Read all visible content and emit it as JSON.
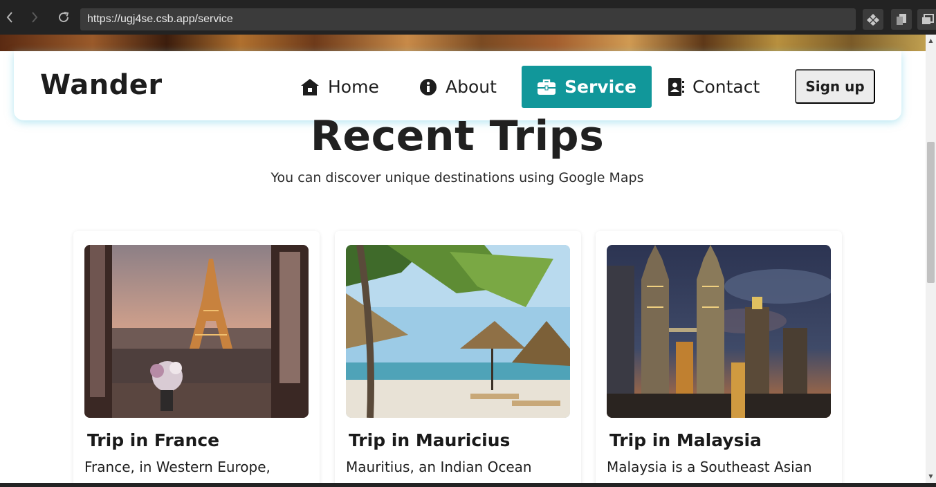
{
  "browser": {
    "url": "https://ugj4se.csb.app/service",
    "back_icon": "chevron-left-icon",
    "forward_icon": "chevron-right-icon",
    "reload_icon": "reload-icon"
  },
  "header": {
    "brand": "Wander",
    "nav": [
      {
        "label": "Home",
        "icon": "home-icon"
      },
      {
        "label": "About",
        "icon": "info-icon"
      },
      {
        "label": "Service",
        "icon": "briefcase-icon",
        "active": true
      },
      {
        "label": "Contact",
        "icon": "contact-card-icon"
      }
    ],
    "signup_label": "Sign up"
  },
  "main": {
    "title": "Recent Trips",
    "subtitle": "You can discover unique destinations using Google Maps",
    "cards": [
      {
        "title": "Trip in France",
        "text": "France, in Western Europe,",
        "image": "eiffel-tower-photo"
      },
      {
        "title": "Trip in Mauricius",
        "text": "Mauritius, an Indian Ocean",
        "image": "beach-umbrellas-photo"
      },
      {
        "title": "Trip in Malaysia",
        "text": "Malaysia is a Southeast Asian",
        "image": "petronas-towers-photo"
      }
    ]
  },
  "colors": {
    "accent": "#11979a",
    "chrome": "#232323",
    "text": "#1d1d1d"
  }
}
